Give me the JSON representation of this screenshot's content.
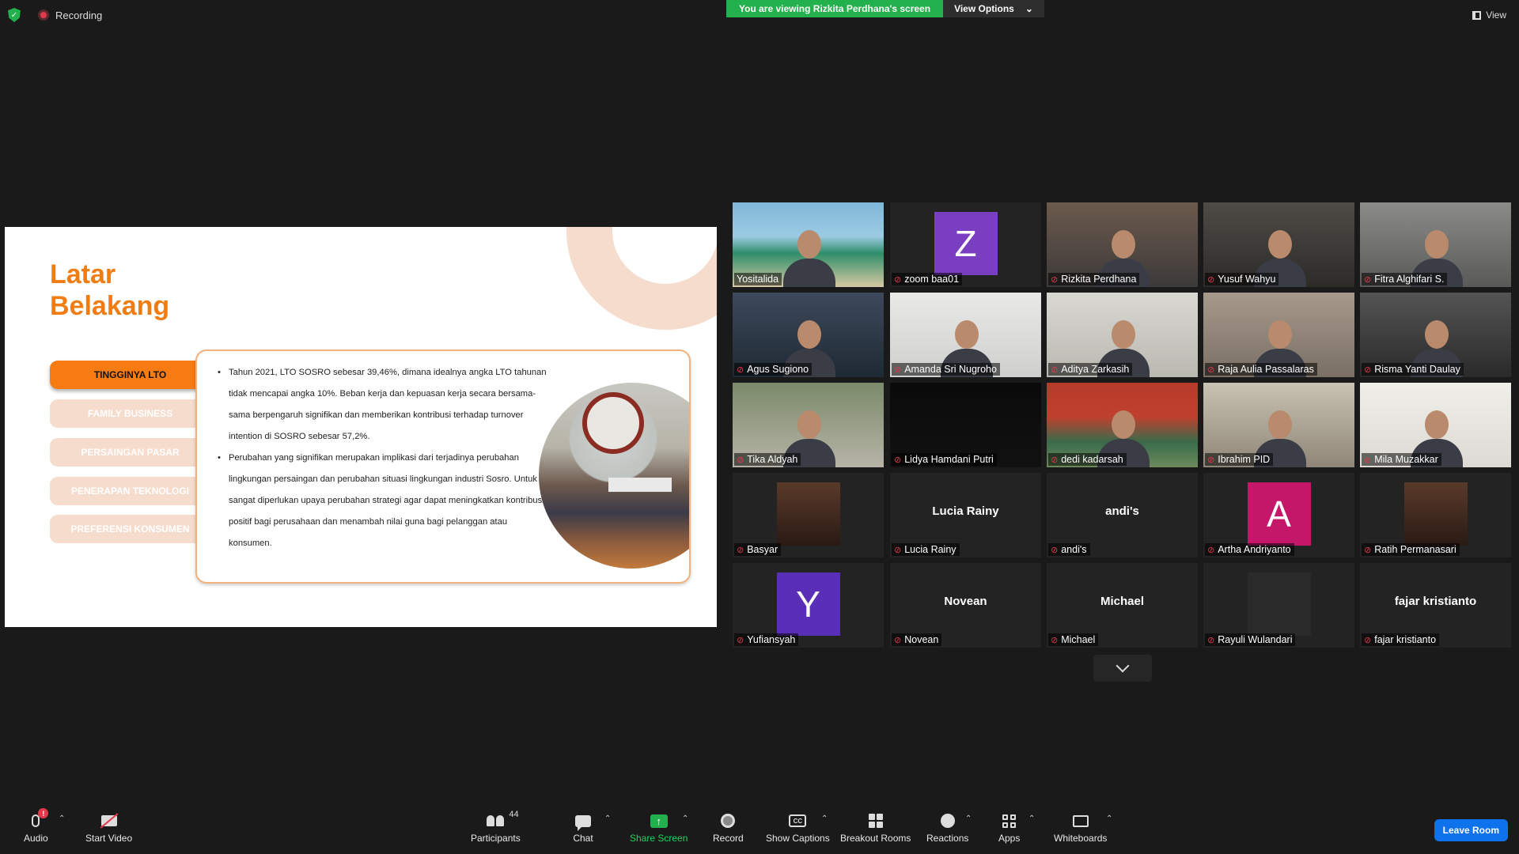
{
  "topbar": {
    "recording_label": "Recording",
    "share_banner": "You are viewing Rizkita Perdhana's screen",
    "view_options": "View Options",
    "view_label": "View"
  },
  "slide": {
    "title_line1": "Latar",
    "title_line2": "Belakang",
    "nav": [
      {
        "label": "TINGGINYA LTO",
        "active": true
      },
      {
        "label": "FAMILY BUSINESS",
        "active": false
      },
      {
        "label": "PERSAINGAN PASAR",
        "active": false
      },
      {
        "label": "PENERAPAN TEKNOLOGI",
        "active": false
      },
      {
        "label": "PREFERENSI KONSUMEN",
        "active": false
      }
    ],
    "bullets": [
      "Tahun 2021, LTO SOSRO sebesar 39,46%, dimana idealnya angka LTO tahunan tidak mencapai angka 10%. Beban kerja dan kepuasan kerja secara bersama-sama berpengaruh signifikan dan memberikan kontribusi terhadap turnover intention di SOSRO sebesar 57,2%.",
      "Perubahan yang signifikan merupakan implikasi dari terjadinya perubahan lingkungan persaingan dan perubahan situasi lingkungan industri Sosro. Untuk itu sangat diperlukan upaya perubahan strategi agar dapat meningkatkan kontribusi positif bagi perusahaan dan menambah nilai guna bagi pelanggan atau konsumen."
    ]
  },
  "participants": [
    {
      "name": "Yositalida",
      "type": "video",
      "muted": false,
      "active": true
    },
    {
      "name": "zoom baa01",
      "type": "avatar",
      "letter": "Z",
      "color": "#7a3fc1",
      "muted": true
    },
    {
      "name": "Rizkita Perdhana",
      "type": "video",
      "muted": true
    },
    {
      "name": "Yusuf Wahyu",
      "type": "video",
      "muted": true
    },
    {
      "name": "Fitra Alghifari S.",
      "type": "video",
      "muted": true
    },
    {
      "name": "Agus Sugiono",
      "type": "video",
      "muted": true
    },
    {
      "name": "Amanda Sri Nugroho",
      "type": "video",
      "muted": true
    },
    {
      "name": "Aditya Zarkasih",
      "type": "video",
      "muted": true
    },
    {
      "name": "Raja Aulia Passalaras",
      "type": "video",
      "muted": true
    },
    {
      "name": "Risma Yanti Daulay",
      "type": "video",
      "muted": true
    },
    {
      "name": "Tika Aldyah",
      "type": "video",
      "muted": true
    },
    {
      "name": "Lidya Hamdani Putri",
      "type": "video",
      "muted": true
    },
    {
      "name": "dedi kadarsah",
      "type": "video",
      "muted": true
    },
    {
      "name": "Ibrahim PID",
      "type": "video",
      "muted": true
    },
    {
      "name": "Mila Muzakkar",
      "type": "video",
      "muted": true
    },
    {
      "name": "Basyar",
      "type": "photo",
      "muted": true
    },
    {
      "name": "Lucia Rainy",
      "type": "name",
      "muted": true
    },
    {
      "name": "andi's",
      "type": "name",
      "muted": true
    },
    {
      "name": "Artha Andriyanto",
      "type": "avatar",
      "letter": "A",
      "color": "#c4176a",
      "muted": true
    },
    {
      "name": "Ratih Permanasari",
      "type": "photo",
      "muted": true
    },
    {
      "name": "Yufiansyah",
      "type": "avatar",
      "letter": "Y",
      "color": "#5a2fb8",
      "muted": true
    },
    {
      "name": "Novean",
      "type": "name",
      "muted": true
    },
    {
      "name": "Michael",
      "type": "name",
      "muted": true
    },
    {
      "name": "Rayuli Wulandari",
      "type": "photo",
      "muted": true
    },
    {
      "name": "fajar kristianto",
      "type": "name",
      "muted": true
    }
  ],
  "toolbar": {
    "audio": "Audio",
    "audio_badge": "!",
    "start_video": "Start Video",
    "participants": "Participants",
    "participants_count": "44",
    "chat": "Chat",
    "share_screen": "Share Screen",
    "record": "Record",
    "show_captions": "Show Captions",
    "cc": "CC",
    "breakout_rooms": "Breakout Rooms",
    "reactions": "Reactions",
    "apps": "Apps",
    "whiteboards": "Whiteboards",
    "leave": "Leave Room"
  },
  "colors": {
    "accent_orange": "#f67b12",
    "share_green": "#23b14d",
    "leave_blue": "#0e72ed",
    "active_speaker": "#f4e85f"
  }
}
